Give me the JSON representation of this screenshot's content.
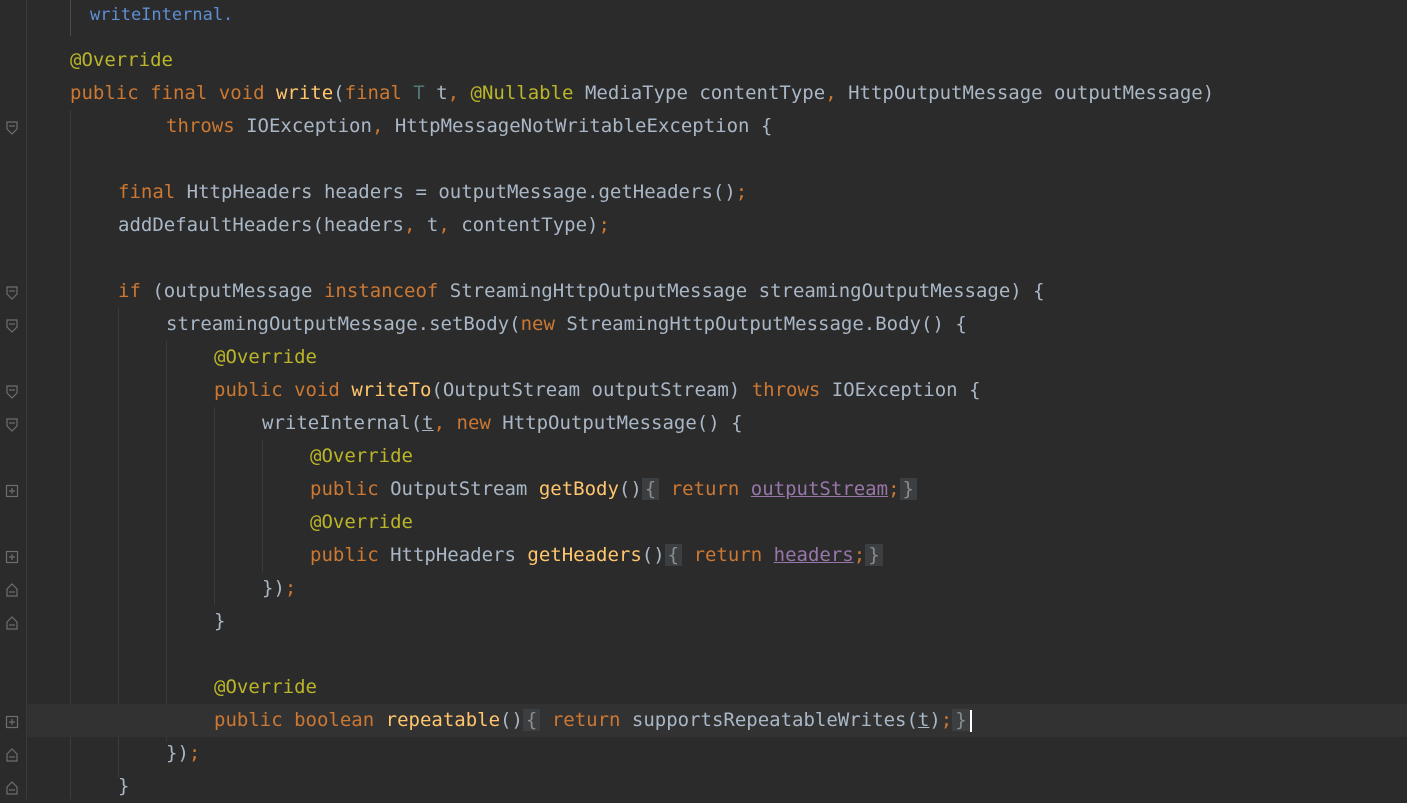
{
  "editor": {
    "doc_fragment": "writeInternal.",
    "lines": {
      "ann_override": "@Override",
      "l_public": "public",
      "l_final": "final",
      "l_void": "void",
      "l_write": "write",
      "l_open": "(",
      "l_final2": "final",
      "l_T": "T",
      "l_t": "t",
      "comma": ",",
      "l_nullable": "@Nullable",
      "l_mediatype": "MediaType",
      "l_contenttype": "contentType",
      "l_httpout": "HttpOutputMessage",
      "l_outputmessage": "outputMessage",
      "close_paren": ")",
      "l_throws": "throws",
      "l_ioexc": "IOException",
      "l_notwritable": "HttpMessageNotWritableException",
      "brace_open": "{",
      "l_httpheaders": "HttpHeaders",
      "l_headers_assign": "headers = outputMessage.getHeaders()",
      "semicolon": ";",
      "l_adddefault": "addDefaultHeaders(headers",
      "l_t_sp": " t",
      "l_contenttype_close": " contentType)",
      "l_if": "if",
      "l_if_open": "(outputMessage",
      "l_instanceof": "instanceof",
      "l_streaming_cond": "StreamingHttpOutputMessage streamingOutputMessage) {",
      "l_setbody": "streamingOutputMessage.setBody(",
      "l_new": "new",
      "l_body": "StreamingHttpOutputMessage.Body() {",
      "l_writeto": "writeTo",
      "l_writeto_args": "(OutputStream outputStream)",
      "l_ioexc_brace": "IOException {",
      "l_writeinternal": "writeInternal(",
      "l_httpout_new": "HttpOutputMessage() {",
      "l_outputstream_t": "OutputStream",
      "l_getbody": "getBody",
      "parens": "()",
      "l_return": "return",
      "l_outputstream_f": "outputStream",
      "brace_close": "}",
      "l_httpheaders2": "HttpHeaders",
      "l_getheaders": "getHeaders",
      "l_headers_f": "headers",
      "l_close_anon": "})",
      "l_close_brace": "}",
      "l_boolean": "boolean",
      "l_repeatable": "repeatable",
      "l_supports": "supportsRepeatableWrites(",
      "l_rparen": ")",
      "l_close_body": "})"
    }
  },
  "colors": {
    "background": "#2b2b2b",
    "keyword": "#cc7832",
    "annotation": "#bbb529",
    "method": "#ffc66d",
    "field": "#9876aa",
    "text": "#a9b7c6",
    "type_param": "#507874"
  },
  "gutter_icons": [
    "fold-collapse-icon",
    "fold-expand-icon",
    "fold-end-icon"
  ]
}
